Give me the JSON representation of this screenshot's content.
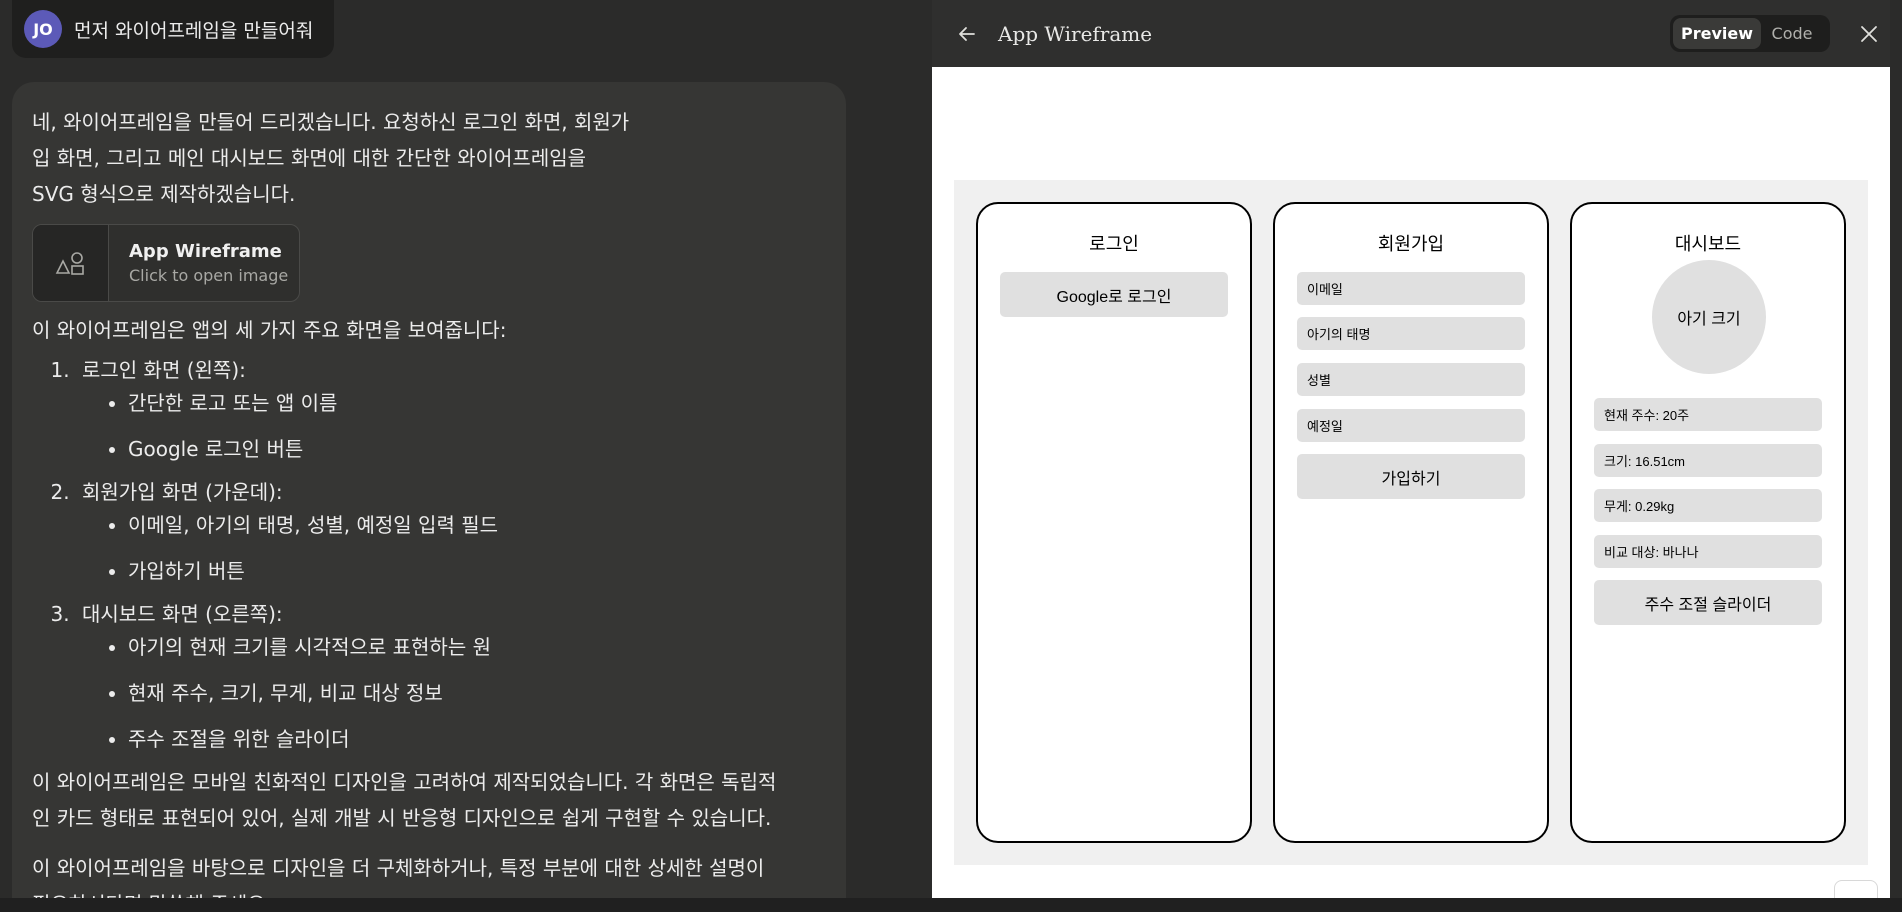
{
  "user_message": {
    "avatar_initials": "JO",
    "text": "먼저 와이어프레임을 만들어줘"
  },
  "assistant": {
    "intro": "네, 와이어프레임을 만들어 드리겠습니다. 요청하신 로그인 화면, 회원가입 화면, 그리고 메인 대시보드 화면에 대한 간단한 와이어프레임을 SVG 형식으로 제작하겠습니다.",
    "artifact": {
      "title": "App Wireframe",
      "subtitle": "Click to open image",
      "icon": "shapes-icon"
    },
    "summary": "이 와이어프레임은 앱의 세 가지 주요 화면을 보여줍니다:",
    "steps": [
      {
        "label": "로그인 화면 (왼쪽):",
        "items": [
          "간단한 로고 또는 앱 이름",
          "Google 로그인 버튼"
        ]
      },
      {
        "label": "회원가입 화면 (가운데):",
        "items": [
          "이메일, 아기의 태명, 성별, 예정일 입력 필드",
          "가입하기 버튼"
        ]
      },
      {
        "label": "대시보드 화면 (오른쪽):",
        "items": [
          "아기의 현재 크기를 시각적으로 표현하는 원",
          "현재 주수, 크기, 무게, 비교 대상 정보",
          "주수 조절을 위한 슬라이더"
        ]
      }
    ],
    "paragraph2": "이 와이어프레임은 모바일 친화적인 디자인을 고려하여 제작되었습니다. 각 화면은 독립적인 카드 형태로 표현되어 있어, 실제 개발 시 반응형 디자인으로 쉽게 구현할 수 있습니다.",
    "paragraph3": "이 와이어프레임을 바탕으로 디자인을 더 구체화하거나, 특정 부분에 대한 상세한 설명이 필요하시다면 말씀해 주세요."
  },
  "panel": {
    "title": "App Wireframe",
    "toggle_preview": "Preview",
    "toggle_code": "Code",
    "back_icon": "arrow-left-icon",
    "close_icon": "close-icon"
  },
  "wireframe": {
    "login": {
      "title": "로그인",
      "google_button": "Google로 로그인"
    },
    "signup": {
      "title": "회원가입",
      "fields": [
        "이메일",
        "아기의 태명",
        "성별",
        "예정일"
      ],
      "submit_button": "가입하기"
    },
    "dashboard": {
      "title": "대시보드",
      "circle_label": "아기 크기",
      "info": [
        "현재 주수: 20주",
        "크기: 16.51cm",
        "무게: 0.29kg",
        "비교 대상: 바나나"
      ],
      "slider_label": "주수 조절 슬라이더"
    }
  },
  "colors": {
    "avatar": "#5c5ab8",
    "background": "#2b2b2a",
    "assistant_bubble": "#363634",
    "wireframe_fill": "#e0e0e0"
  }
}
